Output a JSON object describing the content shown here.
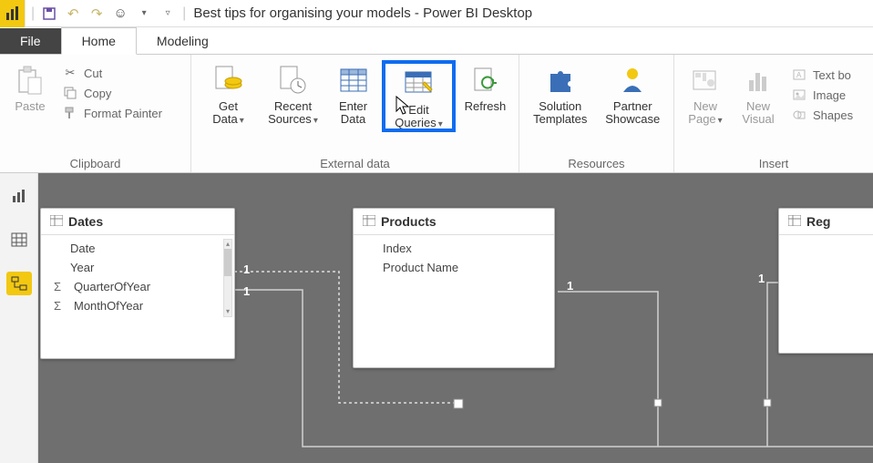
{
  "app": {
    "title": "Best tips for organising your models - Power BI Desktop"
  },
  "tabs": {
    "file": "File",
    "home": "Home",
    "modeling": "Modeling"
  },
  "ribbon": {
    "clipboard": {
      "label": "Clipboard",
      "paste": "Paste",
      "cut": "Cut",
      "copy": "Copy",
      "fmt": "Format Painter"
    },
    "external": {
      "label": "External data",
      "get1": "Get",
      "get2": "Data",
      "recent1": "Recent",
      "recent2": "Sources",
      "enter1": "Enter",
      "enter2": "Data",
      "edit1": "Edit",
      "edit2": "Queries",
      "refresh": "Refresh"
    },
    "resources": {
      "label": "Resources",
      "sol1": "Solution",
      "sol2": "Templates",
      "partner1": "Partner",
      "partner2": "Showcase"
    },
    "insert": {
      "label": "Insert",
      "page1": "New",
      "page2": "Page",
      "visual1": "New",
      "visual2": "Visual",
      "textbox": "Text bo",
      "image": "Image",
      "shapes": "Shapes"
    }
  },
  "model": {
    "tables": [
      {
        "name": "Dates",
        "fields": [
          {
            "label": "Date",
            "sigma": false
          },
          {
            "label": "Year",
            "sigma": false
          },
          {
            "label": "QuarterOfYear",
            "sigma": true
          },
          {
            "label": "MonthOfYear",
            "sigma": true
          }
        ]
      },
      {
        "name": "Products",
        "fields": [
          {
            "label": "Index",
            "sigma": false
          },
          {
            "label": "Product Name",
            "sigma": false
          }
        ]
      },
      {
        "name": "Reg",
        "fields": []
      }
    ],
    "cardinality": {
      "one_a": "1",
      "one_b": "1",
      "one_c": "1",
      "one_d": "1"
    }
  }
}
